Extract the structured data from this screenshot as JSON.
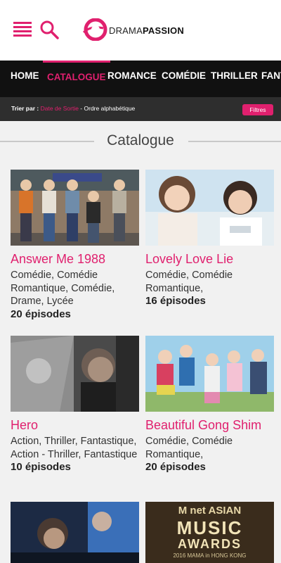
{
  "header": {
    "logo_light": "DRAMA",
    "logo_bold": "PASSION"
  },
  "nav": {
    "items": [
      "HOME",
      "CATALOGUE",
      "ROMANCE",
      "COMÉDIE",
      "THRILLER",
      "FANT"
    ],
    "active_index": 1
  },
  "sort": {
    "label": "Trier par :",
    "option_date": "Date de Sortie",
    "separator": " - ",
    "option_alpha": "Ordre alphabétique",
    "filter_button": "Filtres"
  },
  "section_title": "Catalogue",
  "cards": [
    {
      "title": "Answer Me 1988",
      "genres": "Comédie, Comédie Romantique, Comédie, Drame, Lycée",
      "episodes": "20 épisodes"
    },
    {
      "title": "Lovely Love Lie",
      "genres": "Comédie, Comédie Romantique,",
      "episodes": "16 épisodes"
    },
    {
      "title": "Hero",
      "genres": "Action, Thriller, Fantastique, Action - Thriller, Fantastique",
      "episodes": "10 épisodes"
    },
    {
      "title": "Beautiful Gong Shim",
      "genres": "Comédie, Comédie Romantique,",
      "episodes": "20 épisodes"
    }
  ],
  "bottom_thumbs": [
    {
      "image": "dark-drama-poster"
    },
    {
      "image": "mnet-asian-music-awards-poster",
      "line1": "M net ASIAN",
      "line2": "MUSIC",
      "line3": "AWARDS",
      "line4": "2016 MAMA in HONG KONG"
    }
  ],
  "colors": {
    "accent": "#e0206e",
    "nav_bg": "#111111",
    "sortbar_bg": "#2e2e2e",
    "page_bg": "#f1f1f1"
  }
}
